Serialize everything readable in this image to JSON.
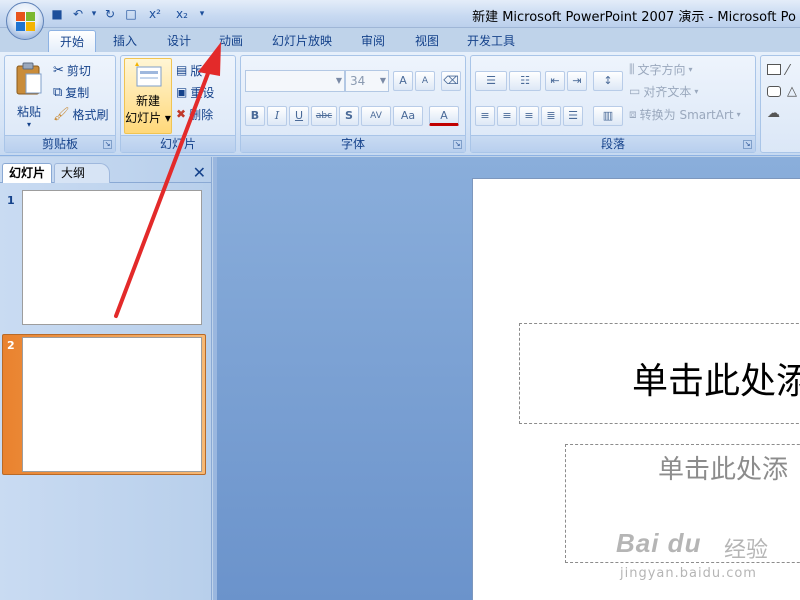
{
  "window": {
    "title": "新建 Microsoft PowerPoint 2007 演示 - Microsoft Po"
  },
  "quick_access": [
    {
      "name": "save-icon",
      "glyph": "■"
    },
    {
      "name": "undo-icon",
      "glyph": "↶"
    },
    {
      "name": "dropdown-icon",
      "glyph": "▾"
    },
    {
      "name": "redo-icon",
      "glyph": "↻"
    },
    {
      "name": "print-preview-icon",
      "glyph": "□"
    },
    {
      "name": "superscript-icon",
      "glyph": "x²"
    },
    {
      "name": "subscript-icon",
      "glyph": "x₂"
    },
    {
      "name": "customize-icon",
      "glyph": "▾"
    }
  ],
  "tabs": [
    "开始",
    "插入",
    "设计",
    "动画",
    "幻灯片放映",
    "审阅",
    "视图",
    "开发工具"
  ],
  "ribbon": {
    "clipboard": {
      "label": "剪贴板",
      "paste": "粘贴",
      "cut": "剪切",
      "copy": "复制",
      "format_painter": "格式刷"
    },
    "slides": {
      "label": "幻灯片",
      "new_slide_line1": "新建",
      "new_slide_line2": "幻灯片",
      "layout": "版",
      "reset": "重设",
      "delete": "删除"
    },
    "font": {
      "label": "字体",
      "font_name": "",
      "font_size": "34",
      "bold": "B",
      "italic": "I",
      "underline": "U",
      "strike": "abc",
      "shadow": "S",
      "spacing": "AV",
      "case": "Aa",
      "grow": "A",
      "shrink": "A",
      "color": "A"
    },
    "paragraph": {
      "label": "段落",
      "text_direction": "文字方向",
      "align_text": "对齐文本",
      "smartart": "转换为 SmartArt"
    }
  },
  "pane": {
    "tab_slides": "幻灯片",
    "tab_outline": "大纲",
    "close": "✕",
    "thumb1_num": "1",
    "thumb2_num": "2"
  },
  "slide": {
    "title_placeholder": "单击此处添",
    "subtitle_placeholder": "单击此处添"
  },
  "watermark": {
    "logo": "Bai du",
    "cn": "经验",
    "url": "jingyan.baidu.com"
  },
  "colors": {
    "accent": "#e32a2a",
    "selected_thumb": "#e9822e"
  }
}
